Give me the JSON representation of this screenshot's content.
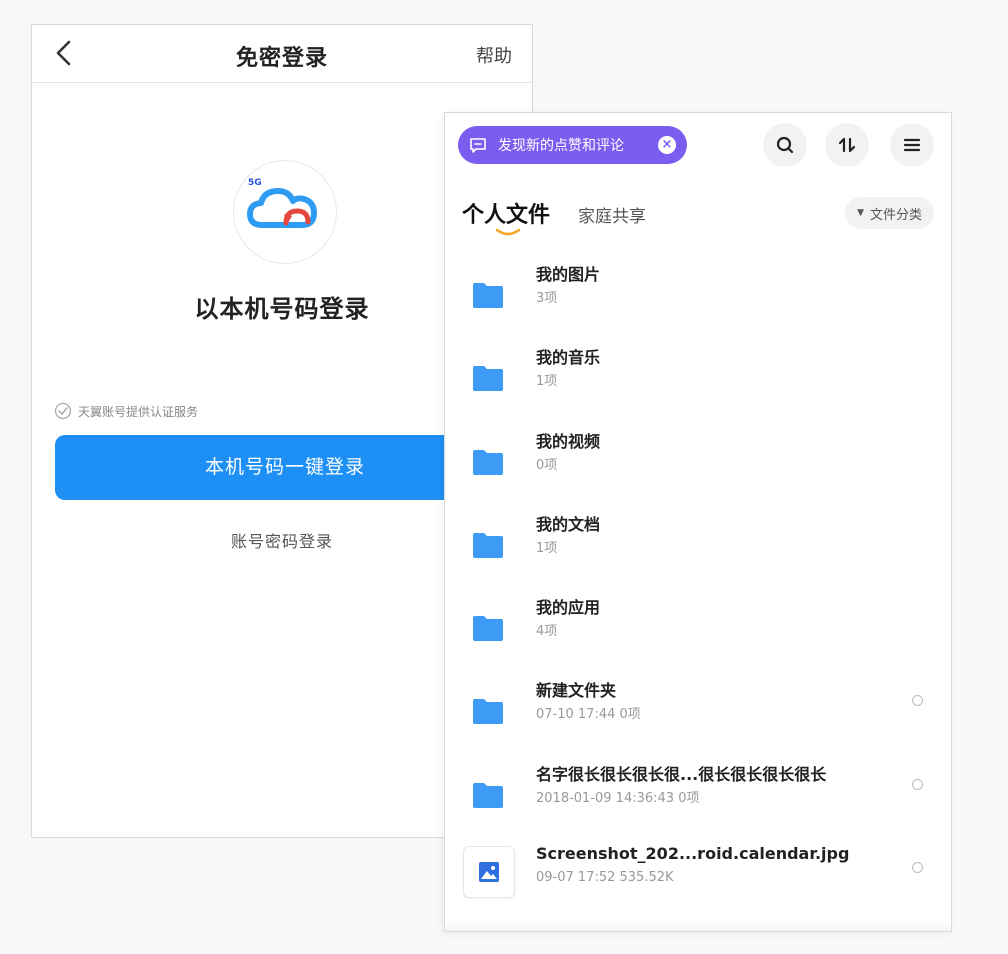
{
  "login": {
    "title": "免密登录",
    "help": "帮助",
    "logo_badge": "5G",
    "heading": "以本机号码登录",
    "service_note": "天翼账号提供认证服务",
    "one_click_button": "本机号码一键登录",
    "password_login": "账号密码登录",
    "colors": {
      "primary": "#1e90f5"
    }
  },
  "files": {
    "notice": {
      "text": "发现新的点赞和评论",
      "close": "×"
    },
    "toolbar": {
      "icons": [
        "search-icon",
        "sort-icon",
        "menu-icon"
      ]
    },
    "tabs": [
      {
        "label": "个人文件",
        "active": true
      },
      {
        "label": "家庭共享",
        "active": false
      }
    ],
    "category_filter": {
      "arrow": "▼",
      "label": "文件分类"
    },
    "items": [
      {
        "type": "folder",
        "name": "我的图片",
        "meta": "3项",
        "selectable": false
      },
      {
        "type": "folder",
        "name": "我的音乐",
        "meta": "1项",
        "selectable": false
      },
      {
        "type": "folder",
        "name": "我的视频",
        "meta": "0项",
        "selectable": false
      },
      {
        "type": "folder",
        "name": "我的文档",
        "meta": "1项",
        "selectable": false
      },
      {
        "type": "folder",
        "name": "我的应用",
        "meta": "4项",
        "selectable": false
      },
      {
        "type": "folder",
        "name": "新建文件夹",
        "meta": "07-10 17:44  0项",
        "selectable": true
      },
      {
        "type": "folder",
        "name": "名字很长很长很长很...很长很长很长很长",
        "meta": "2018-01-09 14:36:43  0项",
        "selectable": true
      },
      {
        "type": "image",
        "name": "Screenshot_202...roid.calendar.jpg",
        "meta": "09-07 17:52  535.52K",
        "selectable": true
      }
    ],
    "colors": {
      "accent": "#7b5ef0",
      "folder": "#3d9af5",
      "tab_underline": "#f5a623"
    }
  }
}
